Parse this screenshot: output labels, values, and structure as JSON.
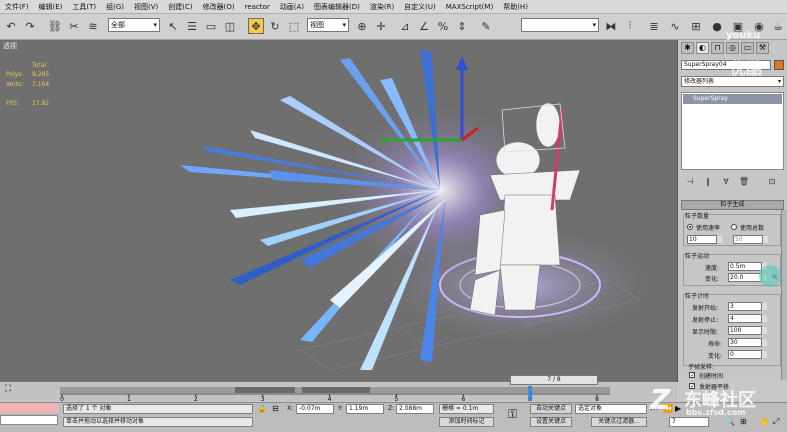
{
  "menubar": {
    "items": [
      "文件(F)",
      "编辑(E)",
      "工具(T)",
      "组(G)",
      "视图(V)",
      "创建(C)",
      "修改器(O)",
      "reactor",
      "动画(A)",
      "图表编辑器(D)",
      "渲染(R)",
      "自定义(U)",
      "MAXScript(M)",
      "帮助(H)"
    ]
  },
  "toolbar": {
    "selection_filter": "全部",
    "reference_coord": "视图",
    "named_selection": ""
  },
  "viewport": {
    "label": "透视",
    "stats": {
      "total_label": "Total",
      "polys_label": "Polys:",
      "polys_value": "9,285",
      "verts_label": "Verts:",
      "verts_value": "7,164",
      "fps_label": "FPS:",
      "fps_value": "17.92"
    }
  },
  "panel": {
    "object_name": "SuperSpray04",
    "object_color": "#e0761f",
    "modifier_list": "修改器列表",
    "stack_item": "SuperSpray",
    "rollout_title": "粒子生成",
    "quantity": {
      "title": "粒子数量",
      "use_rate": "使用速率",
      "use_total": "使用总数",
      "rate_value": "10",
      "total_value": "50"
    },
    "motion": {
      "title": "粒子运动",
      "speed_label": "速度:",
      "speed_value": "0.5m",
      "variation_label": "变化:",
      "variation_value": "20.0",
      "unit": "%"
    },
    "timing": {
      "title": "粒子计时",
      "emit_start_label": "发射开始:",
      "emit_start_value": "3",
      "emit_stop_label": "发射停止:",
      "emit_stop_value": "4",
      "display_until_label": "显示时限:",
      "display_until_value": "100",
      "life_label": "寿命:",
      "life_value": "30",
      "variation_label": "变化:",
      "variation_value": "0"
    },
    "subframe": {
      "title": "子帧采样:",
      "creation_time": "创建时间",
      "emitter_translation": "发射器平移"
    }
  },
  "timeline": {
    "frame_display": "7 / 8",
    "ticks": [
      "0",
      "1",
      "2",
      "3",
      "4",
      "5",
      "6",
      "7",
      "8"
    ],
    "current_frame": 7
  },
  "status": {
    "selection_info": "选择了 1 个 对象",
    "prompt": "单击并拖动以选择并移动对象",
    "x_label": "X:",
    "x_value": "-0.07m",
    "y_label": "Y:",
    "y_value": "1.19m",
    "z_label": "Z:",
    "z_value": "2.088m",
    "grid_label": "栅格 = 0.1m",
    "add_time_tag": "添加时间标记",
    "auto_key": "自动关键点",
    "set_key": "设置关键点",
    "selected_dropdown": "选定对象",
    "key_filters": "关键点过滤器...",
    "frame_field": "7"
  },
  "watermarks": {
    "youku_top": "youku",
    "youku_cn": "优酷",
    "site_brand": "东峰社区",
    "site_url": "bbs.zfsd.com"
  },
  "colors": {
    "viewport_bg": "#6f6f6f",
    "active_tool": "#f2c94c",
    "stats_text": "#e6c84a",
    "stack_highlight": "#8a96a8"
  }
}
